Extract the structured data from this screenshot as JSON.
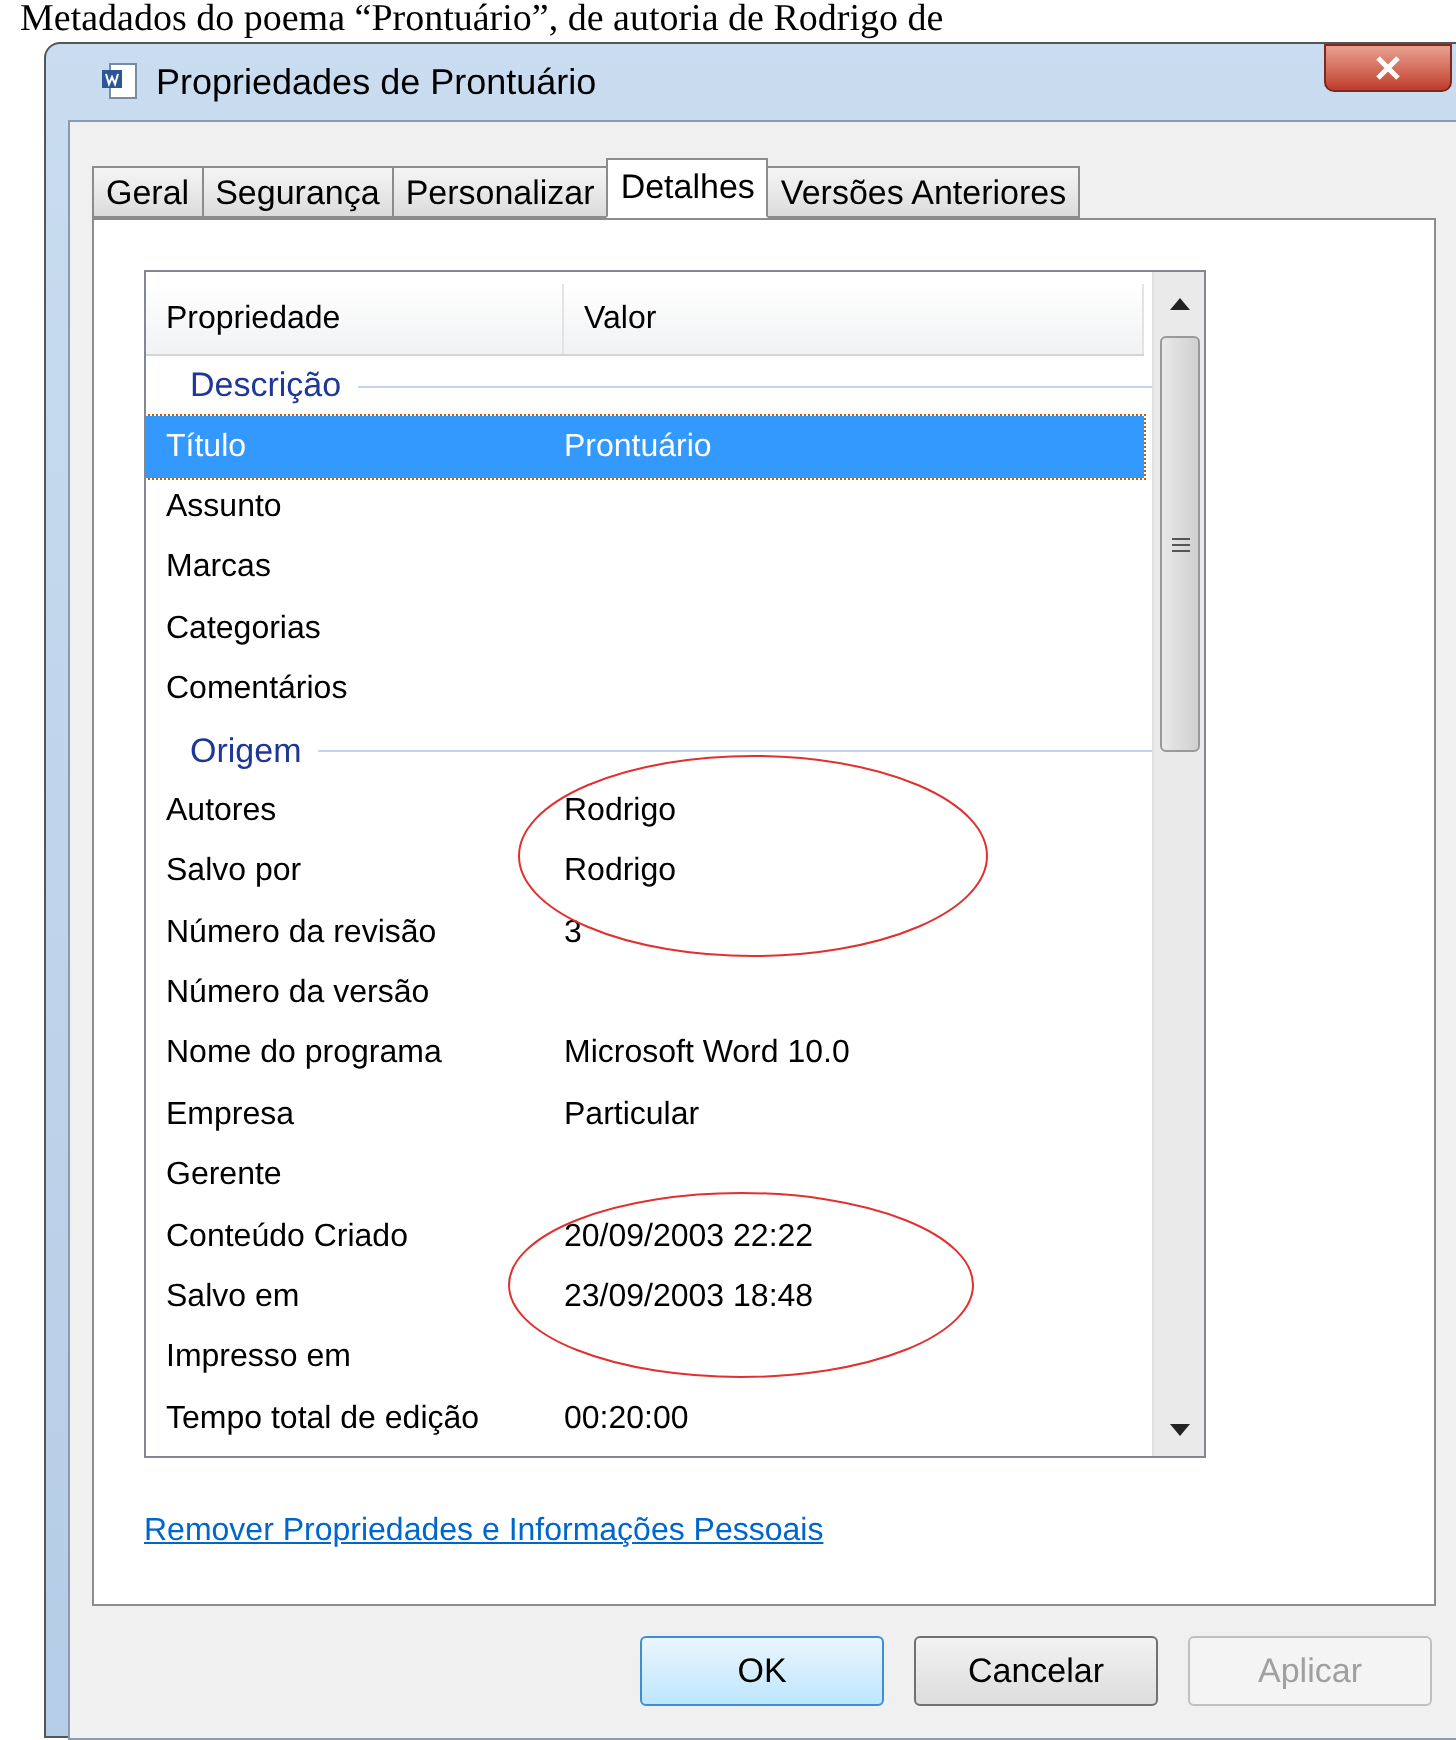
{
  "caption": "Metadados do poema “Prontuário”, de autoria de Rodrigo de",
  "window": {
    "title": "Propriedades de Prontuário"
  },
  "tabs": [
    {
      "label": "Geral",
      "selected": false
    },
    {
      "label": "Segurança",
      "selected": false
    },
    {
      "label": "Personalizar",
      "selected": false
    },
    {
      "label": "Detalhes",
      "selected": true
    },
    {
      "label": "Versões Anteriores",
      "selected": false
    }
  ],
  "table": {
    "columns": [
      "Propriedade",
      "Valor"
    ],
    "groups": [
      {
        "title": "Descrição",
        "rows": [
          {
            "property": "Título",
            "value": "Prontuário",
            "selected": true
          },
          {
            "property": "Assunto",
            "value": "",
            "selected": false
          },
          {
            "property": "Marcas",
            "value": "",
            "selected": false
          },
          {
            "property": "Categorias",
            "value": "",
            "selected": false
          },
          {
            "property": "Comentários",
            "value": "",
            "selected": false
          }
        ]
      },
      {
        "title": "Origem",
        "rows": [
          {
            "property": "Autores",
            "value": "Rodrigo",
            "selected": false
          },
          {
            "property": "Salvo por",
            "value": "Rodrigo",
            "selected": false
          },
          {
            "property": "Número da revisão",
            "value": "3",
            "selected": false
          },
          {
            "property": "Número da versão",
            "value": "",
            "selected": false
          },
          {
            "property": "Nome do programa",
            "value": "Microsoft Word 10.0",
            "selected": false
          },
          {
            "property": "Empresa",
            "value": "Particular",
            "selected": false
          },
          {
            "property": "Gerente",
            "value": "",
            "selected": false
          },
          {
            "property": "Conteúdo Criado",
            "value": "20/09/2003 22:22",
            "selected": false
          },
          {
            "property": "Salvo em",
            "value": "23/09/2003 18:48",
            "selected": false
          },
          {
            "property": "Impresso em",
            "value": "",
            "selected": false
          },
          {
            "property": "Tempo total de edição",
            "value": "00:20:00",
            "selected": false
          }
        ]
      }
    ]
  },
  "link": "Remover Propriedades e Informações Pessoais",
  "buttons": [
    {
      "label": "OK",
      "default": true,
      "disabled": false
    },
    {
      "label": "Cancelar",
      "default": false,
      "disabled": false
    },
    {
      "label": "Aplicar",
      "default": false,
      "disabled": true
    }
  ]
}
